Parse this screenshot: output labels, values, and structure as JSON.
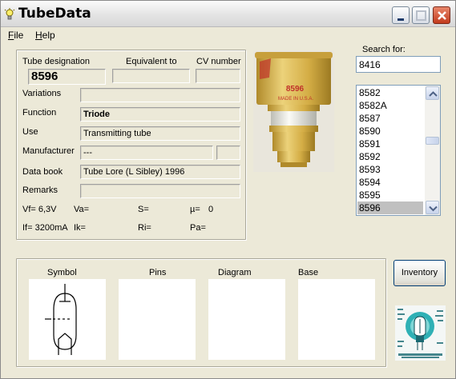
{
  "app": {
    "title": "TubeData"
  },
  "menu": {
    "file": "File",
    "help": "Help"
  },
  "labels": {
    "tube_designation": "Tube designation",
    "equivalent_to": "Equivalent to",
    "cv_number": "CV number",
    "variations": "Variations",
    "function": "Function",
    "use": "Use",
    "manufacturer": "Manufacturer",
    "data_book": "Data book",
    "remarks": "Remarks"
  },
  "fields": {
    "tube_designation": "8596",
    "equivalent_to": "",
    "cv_number": "",
    "variations": "",
    "function": "Triode",
    "use": "Transmitting tube",
    "manufacturer": "---",
    "manufacturer_code": "",
    "data_book": "Tube Lore (L Sibley) 1996",
    "remarks": ""
  },
  "params": {
    "vf": "Vf= 6,3V",
    "va": "Va=",
    "s": "S=",
    "mu": "µ=",
    "mu_value": "0",
    "if": "If= 3200mA",
    "ik": "Ik=",
    "ri": "Ri=",
    "pa": "Pa="
  },
  "photo": {
    "tube_label_line1": "8596",
    "tube_label_line2": "MADE IN U.S.A."
  },
  "search": {
    "label": "Search for:",
    "value": "8416"
  },
  "tube_list": {
    "items": [
      "8582",
      "8582A",
      "8587",
      "8590",
      "8591",
      "8592",
      "8593",
      "8594",
      "8595",
      "8596"
    ],
    "selected": "8596"
  },
  "bottom": {
    "symbol": "Symbol",
    "pins": "Pins",
    "diagram": "Diagram",
    "base": "Base",
    "inventory_button": "Inventory"
  },
  "colors": {
    "accent": "#003c74",
    "selection": "#c0c0c0",
    "tube_gold": "#d7b64a",
    "tube_label_red": "#c0302a"
  }
}
